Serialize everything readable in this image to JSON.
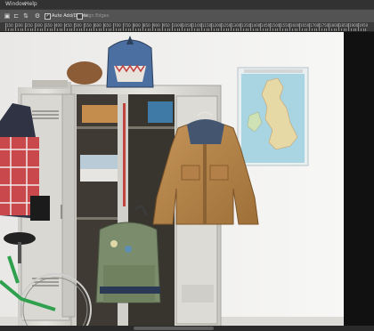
{
  "menu": {
    "items": [
      "Window",
      "Help"
    ]
  },
  "options_bar": {
    "auto_add_label": "Auto Add/Delete",
    "auto_add_checked": true,
    "align_edges_label": "Align Edges",
    "align_edges_checked": false
  },
  "ruler": {
    "labels": [
      "150",
      "200",
      "250",
      "300",
      "350",
      "400",
      "450",
      "500",
      "550",
      "600",
      "650",
      "700",
      "750",
      "800",
      "850",
      "900",
      "950",
      "1000",
      "1050",
      "1100",
      "1150",
      "1200",
      "1250",
      "1300",
      "1350",
      "1400",
      "1450",
      "1500",
      "1550",
      "1600",
      "1650",
      "1700",
      "1750",
      "1800",
      "1850",
      "1900",
      "1950"
    ]
  },
  "colors": {
    "accent": "#535353",
    "canvas_bg": "#f2f1ef",
    "rust": "#b68a52"
  }
}
